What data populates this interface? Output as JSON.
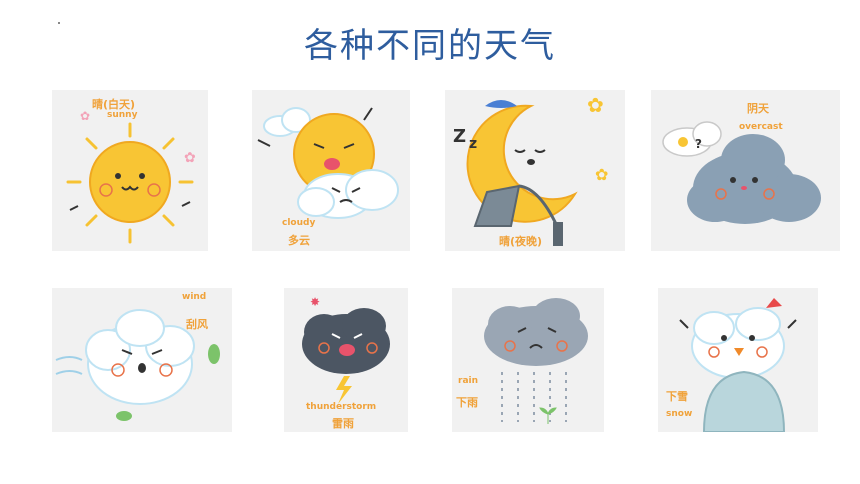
{
  "title": "各种不同的天气",
  "cards": [
    {
      "zh": "晴(白天)",
      "en": "sunny",
      "icon": "sun-icon"
    },
    {
      "zh": "多云",
      "en": "cloudy",
      "icon": "cloudy-icon"
    },
    {
      "zh": "晴(夜晚)",
      "en": "",
      "icon": "moon-icon"
    },
    {
      "zh": "阴天",
      "en": "overcast",
      "icon": "overcast-icon"
    },
    {
      "zh": "刮风",
      "en": "wind",
      "icon": "wind-icon"
    },
    {
      "zh": "雷雨",
      "en": "thunderstorm",
      "icon": "thunderstorm-icon"
    },
    {
      "zh": "下雨",
      "en": "rain",
      "icon": "rain-icon"
    },
    {
      "zh": "下雪",
      "en": "snow",
      "icon": "snow-icon"
    }
  ],
  "colors": {
    "title": "#2e5d9e",
    "label": "#f0a23a",
    "card_bg": "#f1f1f1"
  }
}
